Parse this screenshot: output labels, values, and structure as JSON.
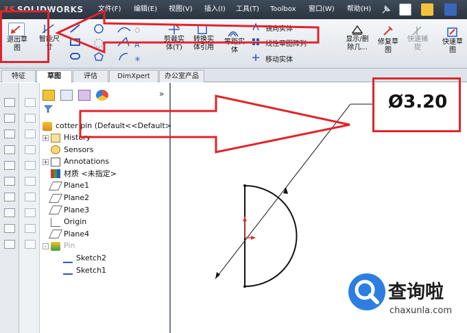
{
  "app": {
    "brand": "SOLIDWORKS",
    "brand_mark": "3S"
  },
  "menu": [
    {
      "label": "文件(F)"
    },
    {
      "label": "编辑(E)"
    },
    {
      "label": "视图(V)"
    },
    {
      "label": "插入(I)"
    },
    {
      "label": "工具(T)"
    },
    {
      "label": "Toolbox"
    },
    {
      "label": "窗口(W)"
    },
    {
      "label": "帮助(H)"
    }
  ],
  "ribbon": {
    "exit_sketch": "退出草\n图",
    "smart_dim": "智能尺\n寸",
    "trim": "剪裁实\n体(T)",
    "convert": "转换实\n体引用",
    "offset": "等距实\n体",
    "mirror_entities": "镜向实体",
    "linear_pattern": "线性草图阵列",
    "move_entities": "移动实体",
    "display_delete": "显示/删\n除几...",
    "repair_sketch": "修复草\n图",
    "quick_snaps": "快速捕\n捉",
    "rapid_sketch": "快速草\n图"
  },
  "tabs": [
    {
      "label": "特征",
      "active": false
    },
    {
      "label": "草图",
      "active": true
    },
    {
      "label": "评估",
      "active": false
    },
    {
      "label": "DimXpert",
      "active": false
    },
    {
      "label": "办公室产品",
      "active": false
    }
  ],
  "tree": {
    "root": "cotter pin  (Default<<Default>",
    "items": [
      {
        "label": "History",
        "icon": "history-icon",
        "expander": "+"
      },
      {
        "label": "Sensors",
        "icon": "sensor-icon",
        "expander": ""
      },
      {
        "label": "Annotations",
        "icon": "annotations-icon",
        "expander": "+"
      },
      {
        "label": "材质 <未指定>",
        "icon": "material-icon",
        "expander": ""
      },
      {
        "label": "Plane1",
        "icon": "plane-icon",
        "expander": ""
      },
      {
        "label": "Plane2",
        "icon": "plane-icon",
        "expander": ""
      },
      {
        "label": "Plane3",
        "icon": "plane-icon",
        "expander": ""
      },
      {
        "label": "Origin",
        "icon": "origin-icon",
        "expander": ""
      },
      {
        "label": "Plane4",
        "icon": "plane-icon",
        "expander": ""
      },
      {
        "label": "Pin",
        "icon": "part-icon",
        "expander": "-"
      },
      {
        "label": "Sketch2",
        "icon": "sketch-icon",
        "expander": ""
      },
      {
        "label": "Sketch1",
        "icon": "sketch-icon",
        "expander": ""
      }
    ]
  },
  "canvas": {
    "dimension_text": "Ø3.20"
  },
  "watermark": {
    "title": "查询啦",
    "url": "chaxunla.com"
  },
  "colors": {
    "annotation_red": "#e0242a",
    "title_bar": "#2b3440",
    "watermark_blue": "#2d7ee0"
  }
}
